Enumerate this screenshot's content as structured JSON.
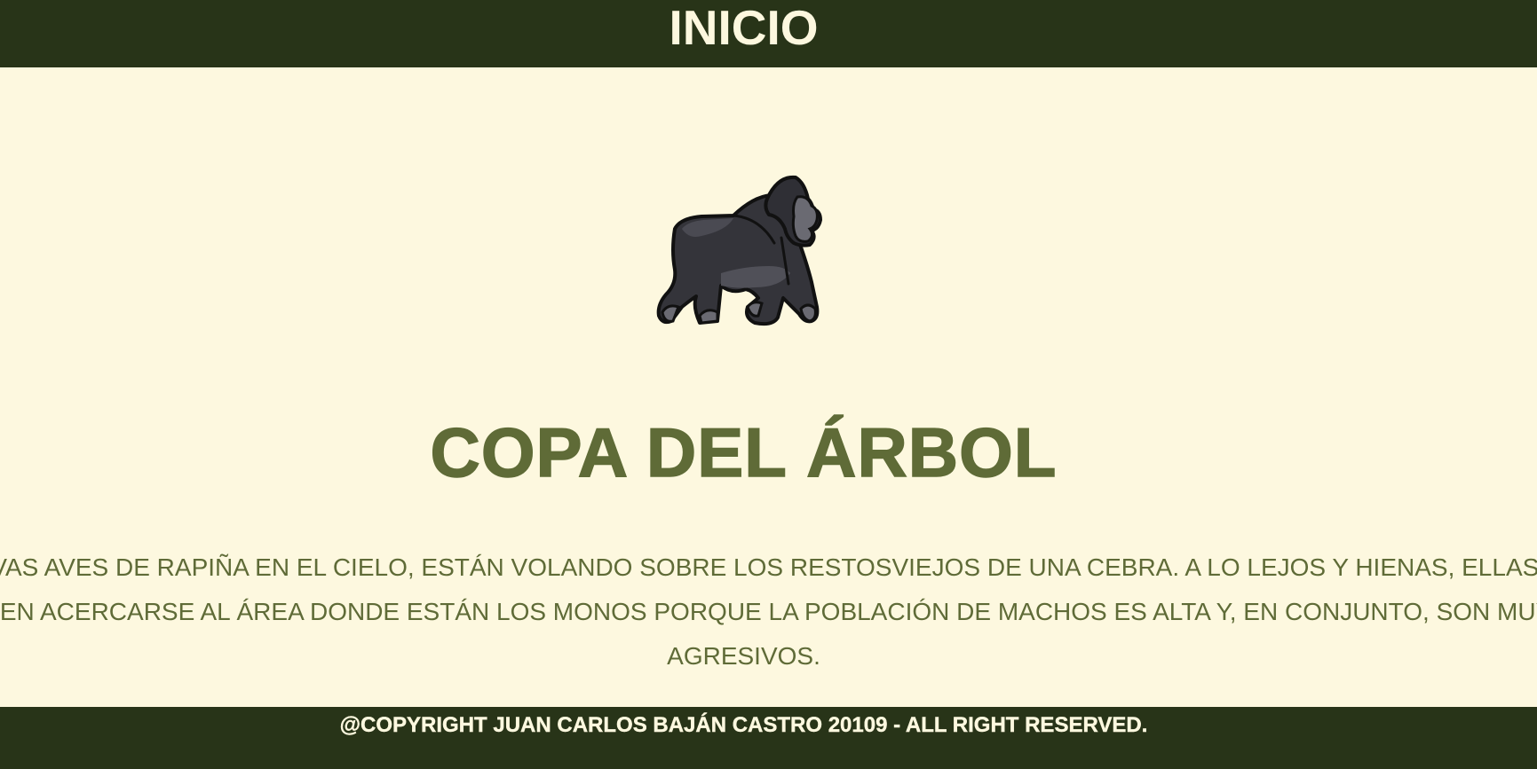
{
  "header": {
    "nav_label": "INICIO"
  },
  "hero": {
    "icon": "gorilla-icon",
    "title": "COPA DEL ÁRBOL",
    "description": "OBSERVAS AVES DE RAPIÑA EN EL CIELO, ESTÁN VOLANDO SOBRE LOS RESTOSVIEJOS DE UNA CEBRA. A LO LEJOS Y HIENAS, ELLAS NO SUELEN ACERCARSE AL ÁREA DONDE ESTÁN LOS MONOS PORQUE LA POBLACIÓN DE MACHOS ES ALTA Y, EN CONJUNTO, SON MUY AGRESIVOS."
  },
  "footer": {
    "copyright": "@COPYRIGHT JUAN CARLOS BAJÁN CASTRO 20109 - ALL RIGHT RESERVED."
  },
  "colors": {
    "background": "#fdf8df",
    "bar": "#283418",
    "accent_text": "#5f6b37",
    "bar_text": "#fdf8df"
  }
}
